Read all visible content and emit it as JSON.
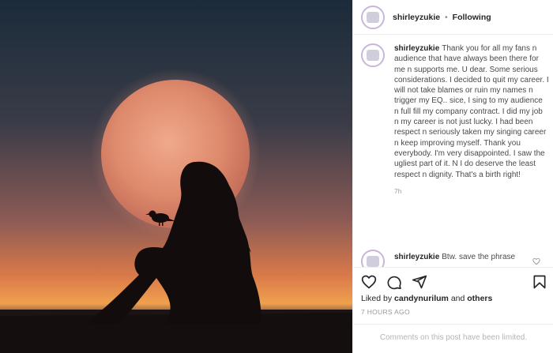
{
  "post": {
    "username": "shirleyzukie",
    "separator": "•",
    "follow_state": "Following",
    "caption": "Thank you for all my fans n audience that have always been there for me n supports me. U dear. Some serious considerations. I decided to quit my career. I will not take blames or ruin my names n trigger my EQ.. sice, I sing to my audience n full fill my company contract. I did my job n my career is not just lucky. I had been respect n seriously taken my singing career n keep improving myself. Thank you everybody. I'm very disappointed. I saw the ugliest part of it. N I do deserve the least respect n dignity. That's a birth right!",
    "caption_time": "7h",
    "second_comment": "Btw. save the phrase",
    "likes_prefix": "Liked by",
    "likes_user": "candynurilum",
    "likes_and": "and",
    "likes_others": "others",
    "posted_ago": "7 HOURS AGO",
    "comments_notice": "Comments on this post have been limited."
  },
  "icons": {
    "like": "heart-icon",
    "comment": "comment-icon",
    "share": "share-icon",
    "save": "bookmark-icon"
  },
  "colors": {
    "text": "#262626",
    "muted": "#8e8e8e",
    "divider": "#efefef",
    "moon": "#e08a6a",
    "sky_top": "#1b2b3a",
    "horizon": "#e9874f"
  }
}
